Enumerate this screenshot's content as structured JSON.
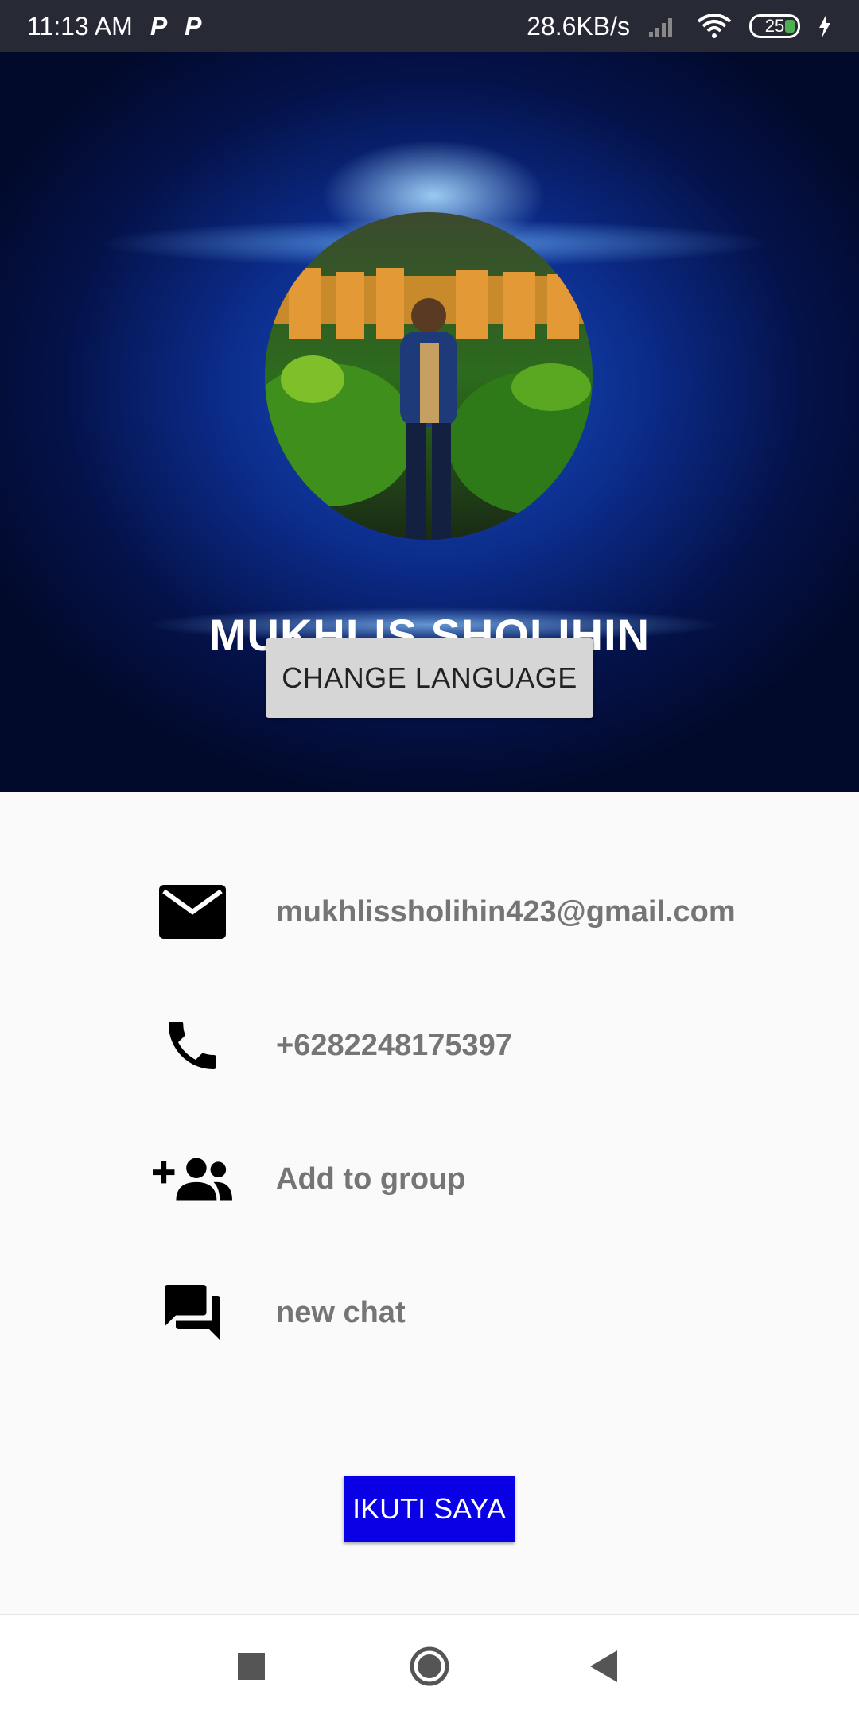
{
  "status_bar": {
    "time": "11:13 AM",
    "notif_icons": [
      "P",
      "P"
    ],
    "net_speed": "28.6KB/s",
    "battery": "25"
  },
  "profile": {
    "name": "MUKHLIS SHOLIHIN",
    "change_language_label": "CHANGE LANGUAGE"
  },
  "info": {
    "email": "mukhlissholihin423@gmail.com",
    "phone": "+6282248175397",
    "add_group": "Add to group",
    "new_chat": "new chat"
  },
  "follow_label": "IKUTI SAYA",
  "colors": {
    "status_bar_bg": "#272a35",
    "follow_btn_bg": "#0a00e6",
    "row_text": "#757575"
  },
  "icons": [
    "email-icon",
    "phone-icon",
    "add-group-icon",
    "chat-icon",
    "recents-icon",
    "home-icon",
    "back-icon"
  ]
}
